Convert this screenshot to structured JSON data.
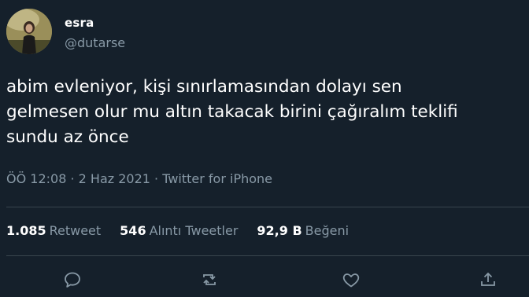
{
  "author": {
    "display_name": "esra",
    "handle": "@dutarse",
    "avatar_icon": "profile-photo"
  },
  "tweet": {
    "lines": [
      "abim evleniyor, kişi sınırlamasından dolayı sen",
      "gelmesen olur mu altın takacak birini çağıralım teklifi",
      "sundu az önce"
    ],
    "meta": "ÖÖ 12:08 · 2 Haz 2021 · Twitter for iPhone"
  },
  "stats": {
    "retweets": {
      "count": "1.085",
      "label": "Retweet"
    },
    "quotes": {
      "count": "546",
      "label": "Alıntı Tweetler"
    },
    "likes": {
      "count": "92,9 B",
      "label": "Beğeni"
    }
  },
  "actions": {
    "reply_icon": "reply-icon",
    "retweet_icon": "retweet-icon",
    "like_icon": "heart-icon",
    "share_icon": "share-icon"
  },
  "colors": {
    "background": "#15202b",
    "secondary_text": "#8899a6",
    "divider": "#38444d"
  }
}
